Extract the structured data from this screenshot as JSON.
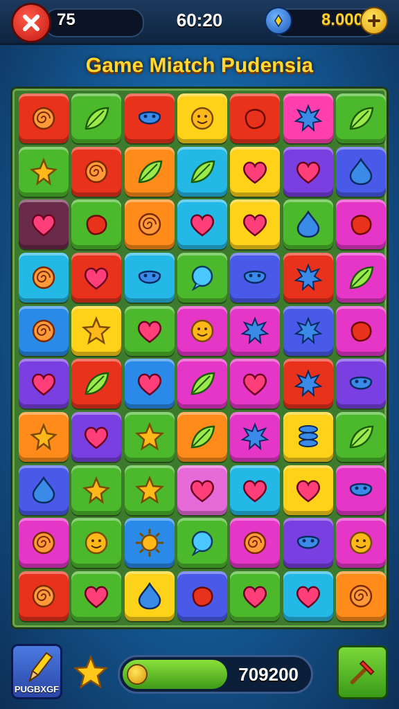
{
  "topbar": {
    "close_icon": "close-icon",
    "lives": "75",
    "timer": "60:20",
    "currency_icon": "gem-icon",
    "coins": "8.000",
    "plus_icon": "plus-icon"
  },
  "title": "Game Miatch Pudensia",
  "board": {
    "columns": 7,
    "rows": 10,
    "tiles": [
      [
        "#e8321c",
        "swirl",
        "#4cb82c",
        "leaf",
        "#e8321c",
        "crab",
        "#ffd21a",
        "face",
        "#e8321c",
        "blob",
        "#ff3fae",
        "spiky",
        "#4cb82c",
        "leaf"
      ],
      [
        "#4cb82c",
        "flower",
        "#e8321c",
        "swirl",
        "#ff8c1a",
        "leaf",
        "#24b8e6",
        "leaf",
        "#ffd21a",
        "heart",
        "#7a3fe0",
        "heart",
        "#4a5ae8",
        "drop"
      ],
      [
        "#6a2a4a",
        "heart",
        "#4cb82c",
        "blob",
        "#ff8c1a",
        "swirl",
        "#24b8e6",
        "heart",
        "#ffd21a",
        "heart",
        "#4cb82c",
        "drop",
        "#e636c8",
        "blob"
      ],
      [
        "#24b8e6",
        "swirl",
        "#e8321c",
        "heart",
        "#24b8e6",
        "crab",
        "#4cb82c",
        "bubble",
        "#4a5ae8",
        "crab",
        "#e8321c",
        "spiky",
        "#e636c8",
        "leaf"
      ],
      [
        "#2a8ae8",
        "swirl",
        "#ffd21a",
        "star",
        "#4cb82c",
        "heart",
        "#e636c8",
        "face",
        "#e636c8",
        "spiky",
        "#4a5ae8",
        "spiky",
        "#e636c8",
        "blob"
      ],
      [
        "#7a3fe0",
        "heart",
        "#e8321c",
        "leaf",
        "#2a8ae8",
        "heart",
        "#e636c8",
        "leaf",
        "#e636c8",
        "heart",
        "#e8321c",
        "spiky",
        "#7a3fe0",
        "crab"
      ],
      [
        "#ff8c1a",
        "flower",
        "#7a3fe0",
        "heart",
        "#4cb82c",
        "star",
        "#ff8c1a",
        "leaf",
        "#e636c8",
        "spiky",
        "#ffd21a",
        "stack",
        "#4cb82c",
        "leaf"
      ],
      [
        "#4a5ae8",
        "drop",
        "#4cb82c",
        "flower",
        "#4cb82c",
        "star",
        "#e66ad8",
        "heart",
        "#24b8e6",
        "heart",
        "#ffd21a",
        "heart",
        "#e636c8",
        "crab"
      ],
      [
        "#e636c8",
        "swirl",
        "#4cb82c",
        "face",
        "#2a8ae8",
        "sun",
        "#4cb82c",
        "bubble",
        "#e636c8",
        "swirl",
        "#7a3fe0",
        "crab",
        "#e636c8",
        "face"
      ],
      [
        "#e8321c",
        "swirl",
        "#4cb82c",
        "heart",
        "#ffd21a",
        "drop",
        "#4a5ae8",
        "blob",
        "#4cb82c",
        "heart",
        "#24b8e6",
        "heart",
        "#ff8c1a",
        "swirl"
      ]
    ]
  },
  "bottombar": {
    "powerup_label": "PUGBXGF",
    "score": "709200",
    "score_progress": 0.55
  }
}
